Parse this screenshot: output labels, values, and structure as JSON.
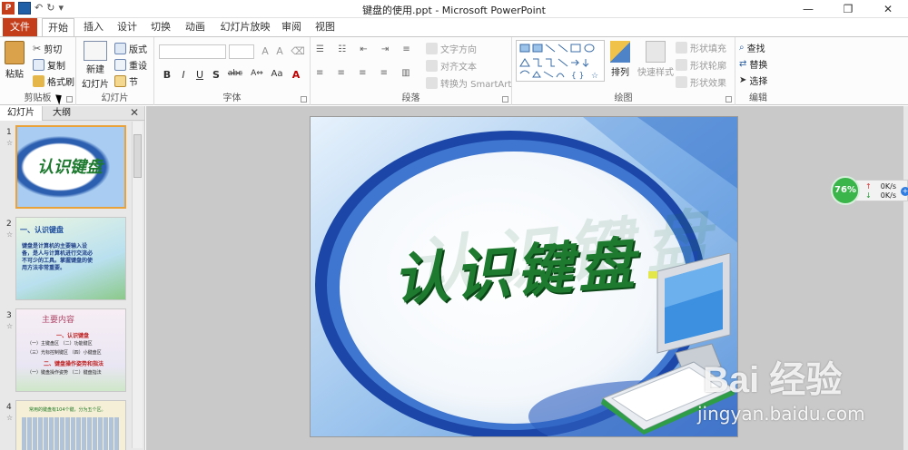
{
  "window": {
    "title": "键盘的使用.ppt - Microsoft PowerPoint",
    "app_icon_label": "P",
    "controls": [
      "—",
      "❐",
      "✕"
    ]
  },
  "tabs": [
    {
      "label": "文件",
      "type": "file"
    },
    {
      "label": "开始",
      "active": true
    },
    {
      "label": "插入"
    },
    {
      "label": "设计"
    },
    {
      "label": "切换"
    },
    {
      "label": "动画"
    },
    {
      "label": "幻灯片放映"
    },
    {
      "label": "审阅"
    },
    {
      "label": "视图"
    }
  ],
  "ribbon": {
    "clipboard": {
      "label": "剪贴板",
      "paste": "粘贴",
      "cut": "剪切",
      "copy": "复制",
      "format_painter": "格式刷"
    },
    "slides": {
      "label": "幻灯片",
      "new_slide_1": "新建",
      "new_slide_2": "幻灯片",
      "layout": "版式",
      "reset": "重设",
      "section": "节"
    },
    "font": {
      "label": "字体",
      "buttons": [
        "B",
        "I",
        "U",
        "S",
        "abc",
        "A⇔",
        "Aa",
        "A"
      ]
    },
    "paragraph": {
      "label": "段落",
      "text_direction": "文字方向",
      "align_text": "对齐文本",
      "smartart": "转换为 SmartArt"
    },
    "drawing": {
      "label": "绘图",
      "arrange": "排列",
      "quick_styles": "快速样式",
      "shape_fill": "形状填充",
      "shape_outline": "形状轮廓",
      "shape_effects": "形状效果"
    },
    "editing": {
      "label": "编辑",
      "find": "查找",
      "replace": "替换",
      "select": "选择"
    }
  },
  "left_pane": {
    "tabs": [
      "幻灯片",
      "大纲"
    ],
    "close": "✕",
    "slides": [
      {
        "num": "1",
        "title": "认识键盘"
      },
      {
        "num": "2",
        "title": "一、认识键盘",
        "body": "键盘是计算机的主要输入设备，是人与计算机进行交流必不可少的工具。掌握键盘的使用方法非常重要。"
      },
      {
        "num": "3",
        "title": "主要内容",
        "lines": [
          "一、认识键盘",
          "（一）主键盘区 （二）功能键区",
          "（三）光标控制键区 （四）小键盘区",
          "二、键盘操作姿势和指法",
          "（一）键盘操作姿势 （二）键盘指法"
        ]
      },
      {
        "num": "4",
        "title": "常用的键盘有104个键，分为五个区。"
      }
    ]
  },
  "slide": {
    "title": "认识键盘"
  },
  "net_widget": {
    "percent": "76%",
    "up": "0K/s",
    "down": "0K/s"
  },
  "watermark": {
    "logo": "Bai 经验",
    "url": "jingyan.baidu.com"
  }
}
